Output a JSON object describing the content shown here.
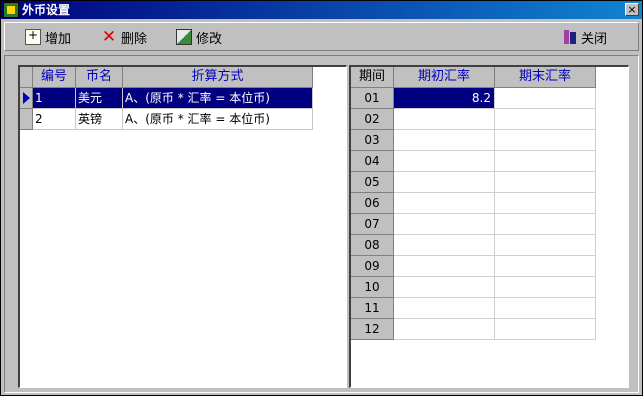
{
  "window": {
    "title": "外币设置",
    "close_glyph": "×"
  },
  "toolbar": {
    "add_label": "增加",
    "delete_label": "删除",
    "edit_label": "修改",
    "close_label": "关闭"
  },
  "currency_table": {
    "columns": [
      "编号",
      "币名",
      "折算方式"
    ],
    "rows": [
      {
        "code": "1",
        "name": "美元",
        "method": "A、(原币 * 汇率 = 本位币)",
        "selected": true
      },
      {
        "code": "2",
        "name": "英镑",
        "method": "A、(原币 * 汇率 = 本位币)",
        "selected": false
      }
    ]
  },
  "rate_table": {
    "columns": [
      "期间",
      "期初汇率",
      "期末汇率"
    ],
    "rows": [
      {
        "period": "01",
        "begin_rate": "8.2",
        "end_rate": ""
      },
      {
        "period": "02",
        "begin_rate": "",
        "end_rate": ""
      },
      {
        "period": "03",
        "begin_rate": "",
        "end_rate": ""
      },
      {
        "period": "04",
        "begin_rate": "",
        "end_rate": ""
      },
      {
        "period": "05",
        "begin_rate": "",
        "end_rate": ""
      },
      {
        "period": "06",
        "begin_rate": "",
        "end_rate": ""
      },
      {
        "period": "07",
        "begin_rate": "",
        "end_rate": ""
      },
      {
        "period": "08",
        "begin_rate": "",
        "end_rate": ""
      },
      {
        "period": "09",
        "begin_rate": "",
        "end_rate": ""
      },
      {
        "period": "10",
        "begin_rate": "",
        "end_rate": ""
      },
      {
        "period": "11",
        "begin_rate": "",
        "end_rate": ""
      },
      {
        "period": "12",
        "begin_rate": "",
        "end_rate": ""
      }
    ]
  },
  "icons": {
    "app": "app-icon",
    "add": "add-document-icon",
    "delete": "red-x-icon",
    "edit": "edit-icon",
    "close": "exit-door-icon",
    "row_indicator": "row-pointer-icon"
  },
  "colors": {
    "title_bar": "#000080",
    "selection": "#000080",
    "header_text": "#0000c0",
    "delete_icon": "#e00000"
  }
}
